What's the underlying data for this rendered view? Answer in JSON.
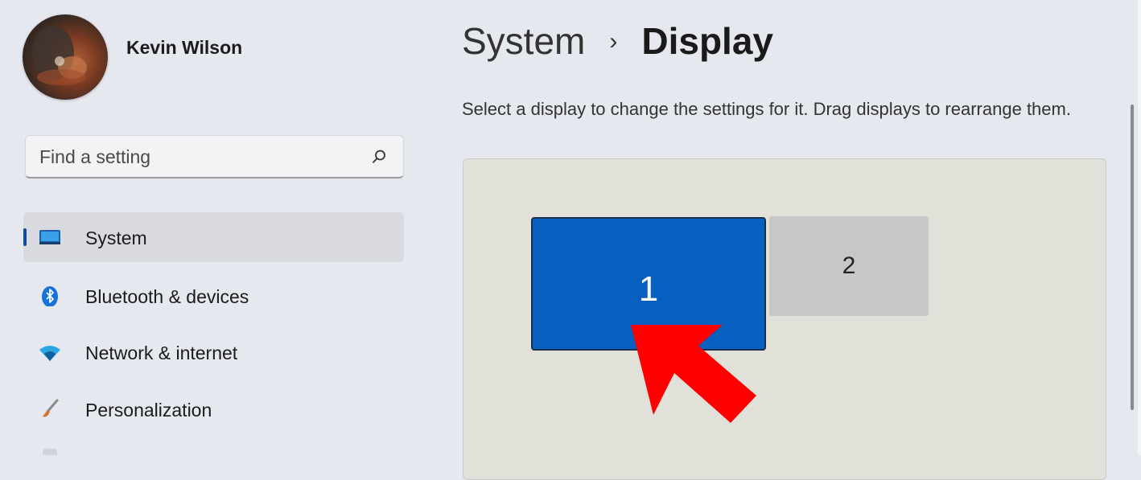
{
  "user": {
    "name": "Kevin Wilson"
  },
  "search": {
    "placeholder": "Find a setting"
  },
  "sidebar": {
    "items": [
      {
        "label": "System",
        "icon": "display-icon",
        "active": true
      },
      {
        "label": "Bluetooth & devices",
        "icon": "bluetooth-icon",
        "active": false
      },
      {
        "label": "Network & internet",
        "icon": "wifi-icon",
        "active": false
      },
      {
        "label": "Personalization",
        "icon": "brush-icon",
        "active": false
      }
    ]
  },
  "breadcrumb": {
    "parent": "System",
    "separator": "›",
    "current": "Display"
  },
  "main": {
    "description": "Select a display to change the settings for it. Drag displays to rearrange them."
  },
  "displays": [
    {
      "number": "1",
      "selected": true
    },
    {
      "number": "2",
      "selected": false
    }
  ],
  "colors": {
    "accent": "#0a4da3",
    "selected_display": "#0760bf",
    "unselected_display": "#c7c7c7",
    "annotation_arrow": "#ff0000"
  }
}
